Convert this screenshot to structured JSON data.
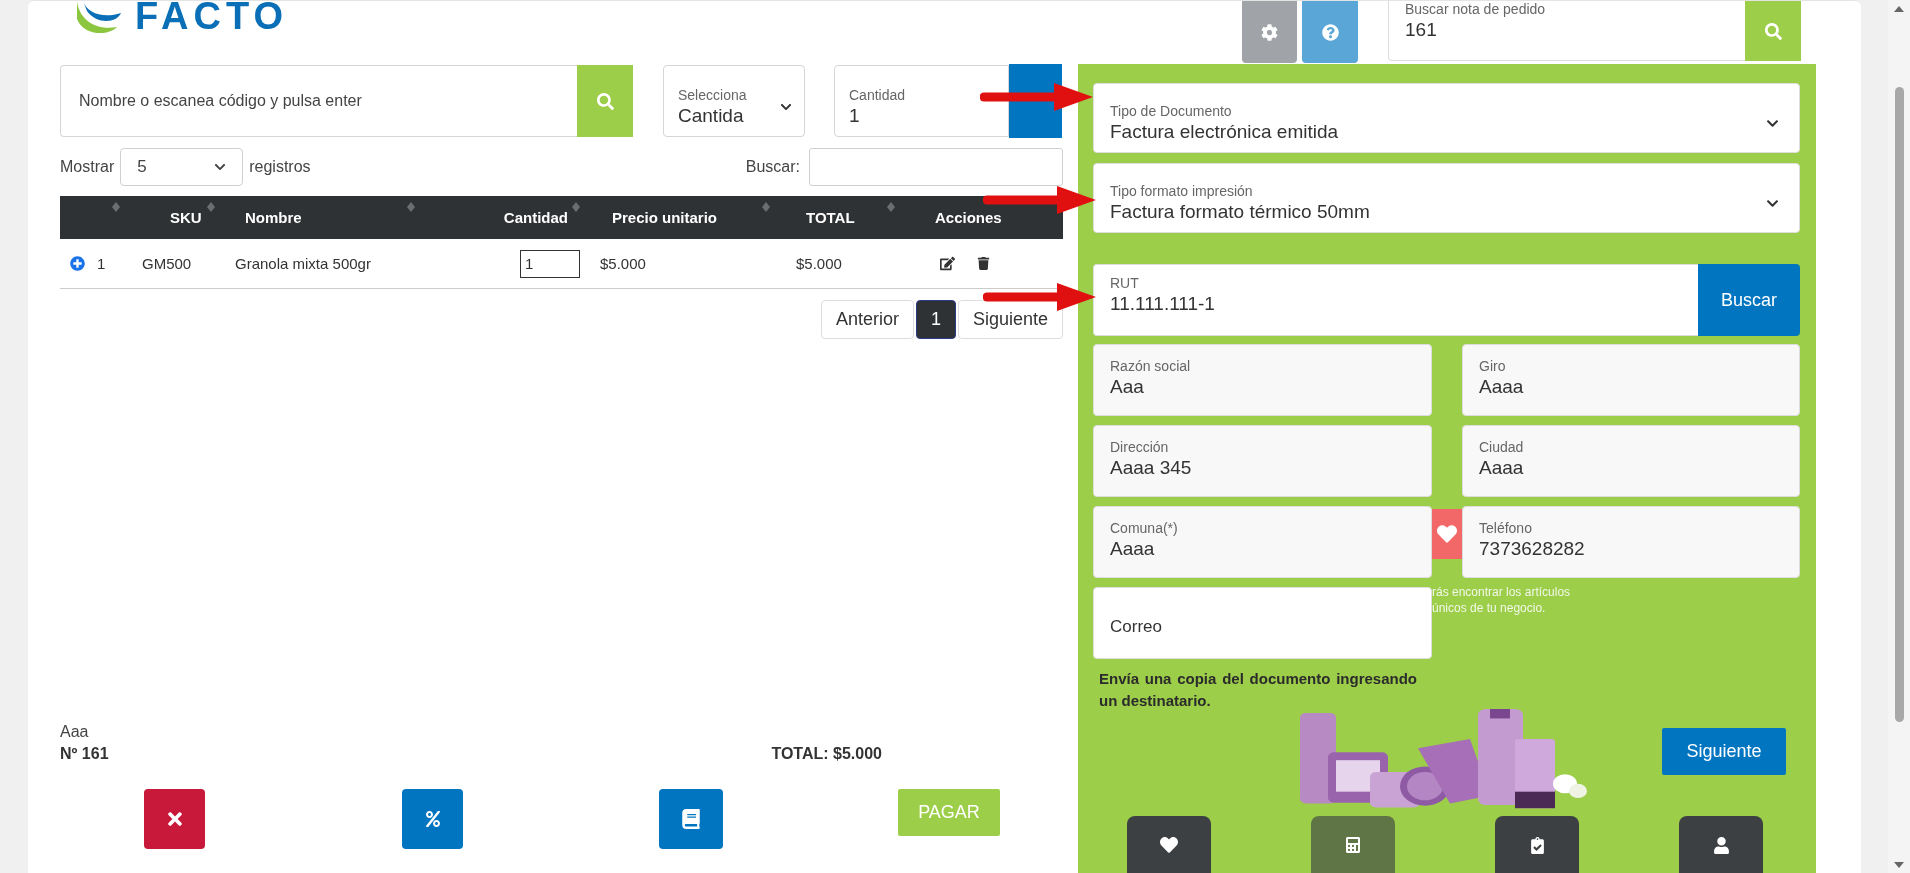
{
  "logo": {
    "text": "FACTO"
  },
  "order_search": {
    "label": "Buscar nota de pedido",
    "value": "161"
  },
  "product_search": {
    "placeholder": "Nombre o escanea código y pulsa enter"
  },
  "unit_select": {
    "label": "Selecciona",
    "value": "Cantida"
  },
  "quantity": {
    "label": "Cantidad",
    "value": "1"
  },
  "length_menu": {
    "before": "Mostrar",
    "value": "5",
    "after": "registros"
  },
  "table_search": {
    "label": "Buscar:"
  },
  "table": {
    "columns": [
      "SKU",
      "Nombre",
      "Cantidad",
      "Precio unitario",
      "TOTAL",
      "Acciones"
    ],
    "rows": [
      {
        "index": "1",
        "sku": "GM500",
        "name": "Granola mixta 500gr",
        "quantity": "1",
        "unit_price": "$5.000",
        "total": "$5.000"
      }
    ]
  },
  "pagination": [
    {
      "label": "Anterior",
      "selected": false
    },
    {
      "label": "1",
      "selected": true
    },
    {
      "label": "Siguiente",
      "selected": false
    }
  ],
  "summary": {
    "client": "Aaa",
    "number": "Nº 161",
    "total": "TOTAL: $5.000"
  },
  "actions": {
    "pay": "PAGAR"
  },
  "document_form": {
    "document_type": {
      "label": "Tipo de Documento",
      "value": "Factura electrónica emitida"
    },
    "print_format": {
      "label": "Tipo formato impresión",
      "value": "Factura formato térmico 50mm"
    },
    "rut": {
      "label": "RUT",
      "value": "11.111.111-1",
      "button": "Buscar"
    },
    "fields": [
      {
        "label": "Razón social",
        "value": "Aaa"
      },
      {
        "label": "Giro",
        "value": "Aaaa"
      },
      {
        "label": "Dirección",
        "value": "Aaaa 345"
      },
      {
        "label": "Ciudad",
        "value": "Aaaa"
      },
      {
        "label": "Comuna(*)",
        "value": "Aaaa"
      },
      {
        "label": "Teléfono",
        "value": "7373628282"
      }
    ],
    "email": {
      "placeholder": "Correo"
    },
    "note": "Envía una copia del documento ingresando un destinatario.",
    "promo_lines": [
      "rás encontrar los artículos",
      "únicos de tu negocio."
    ],
    "next_button": "Siguiente"
  },
  "bottom_nav": [
    {
      "kind": "heart",
      "selected": false
    },
    {
      "kind": "calculator",
      "selected": true
    },
    {
      "kind": "clipboard",
      "selected": false
    },
    {
      "kind": "user",
      "selected": false
    }
  ]
}
